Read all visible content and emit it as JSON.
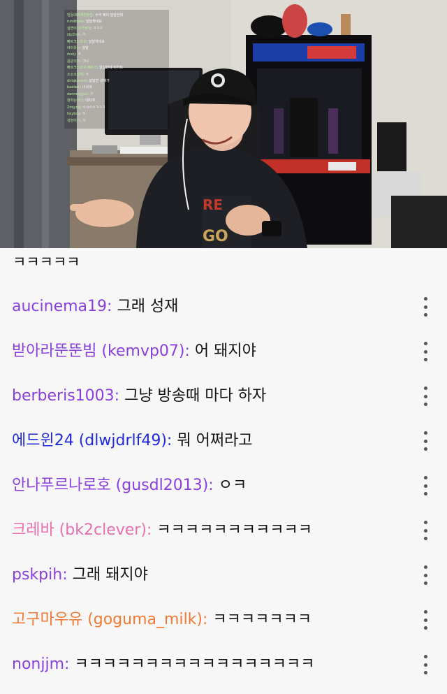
{
  "video": {
    "overlay_chat": [
      {
        "name": "빈둥대며깨끗봤습",
        "text": "수석 왜이 달달한데"
      },
      {
        "name": "rundbyee",
        "text": "달달하네요"
      },
      {
        "name": "실연이 나가헤헤",
        "text": "ㅋㅋㅋ"
      },
      {
        "name": "idp3nlk",
        "text": "ㅋ"
      },
      {
        "name": "빠르크느르슈",
        "text": "달달하네요"
      },
      {
        "name": "아이유는",
        "text": "달달"
      },
      {
        "name": "rkskj",
        "text": "ㅋ"
      },
      {
        "name": "윤운이즈",
        "text": "그니"
      },
      {
        "name": "빠르크느르슈 빠르크",
        "text": "달달한데 비하트"
      },
      {
        "name": "소소소성자",
        "text": "ㅋ"
      },
      {
        "name": "dnlqkwnsld",
        "text": "달달한 성재가"
      },
      {
        "name": "baelam",
        "text": "너나야"
      },
      {
        "name": "danmoyjjun",
        "text": "ㅋ"
      },
      {
        "name": "원하는거다",
        "text": "데지야"
      },
      {
        "name": "Zmjyrqj",
        "text": "ㅇㅇㅇㅇㅋㅋㅋ"
      },
      {
        "name": "heyboy",
        "text": "ㅋ"
      },
      {
        "name": "성현이가",
        "text": "ㅋ"
      }
    ]
  },
  "chat": {
    "partial_top_text": "ㅋㅋㅋㅋㅋ",
    "messages": [
      {
        "user": "aucinema19",
        "separator": ":",
        "text": "그래 성재",
        "color": "#8a3fdc"
      },
      {
        "user": "받아라뚠뚠빔 (kemvp07)",
        "separator": ":",
        "text": "어 돼지야",
        "color": "#8a3fdc"
      },
      {
        "user": "berberis1003",
        "separator": ":",
        "text": "그냥 방송때 마다 하자",
        "color": "#8a3fdc"
      },
      {
        "user": "에드윈24 (dlwjdrlf49)",
        "separator": ":",
        "text": "뭐 어쩌라고",
        "color": "#1f2adb"
      },
      {
        "user": "안나푸르나로호 (gusdl2013)",
        "separator": ":",
        "text": "ㅇㅋ",
        "color": "#8a3fdc"
      },
      {
        "user": "크레바 (bk2clever)",
        "separator": ":",
        "text": "ㅋㅋㅋㅋㅋㅋㅋㅋㅋㅋㅋ",
        "color": "#e86fb0"
      },
      {
        "user": "pskpih",
        "separator": ":",
        "text": "그래 돼지야",
        "color": "#8a3fdc"
      },
      {
        "user": "고구마우유 (goguma_milk)",
        "separator": ":",
        "text": "ㅋㅋㅋㅋㅋㅋㅋ",
        "color": "#f07a35"
      },
      {
        "user": "nonjjm",
        "separator": ":",
        "text": "ㅋㅋㅋㅋㅋㅋㅋㅋㅋㅋㅋㅋㅋㅋㅋㅋㅋ",
        "color": "#8a3fdc"
      }
    ]
  }
}
